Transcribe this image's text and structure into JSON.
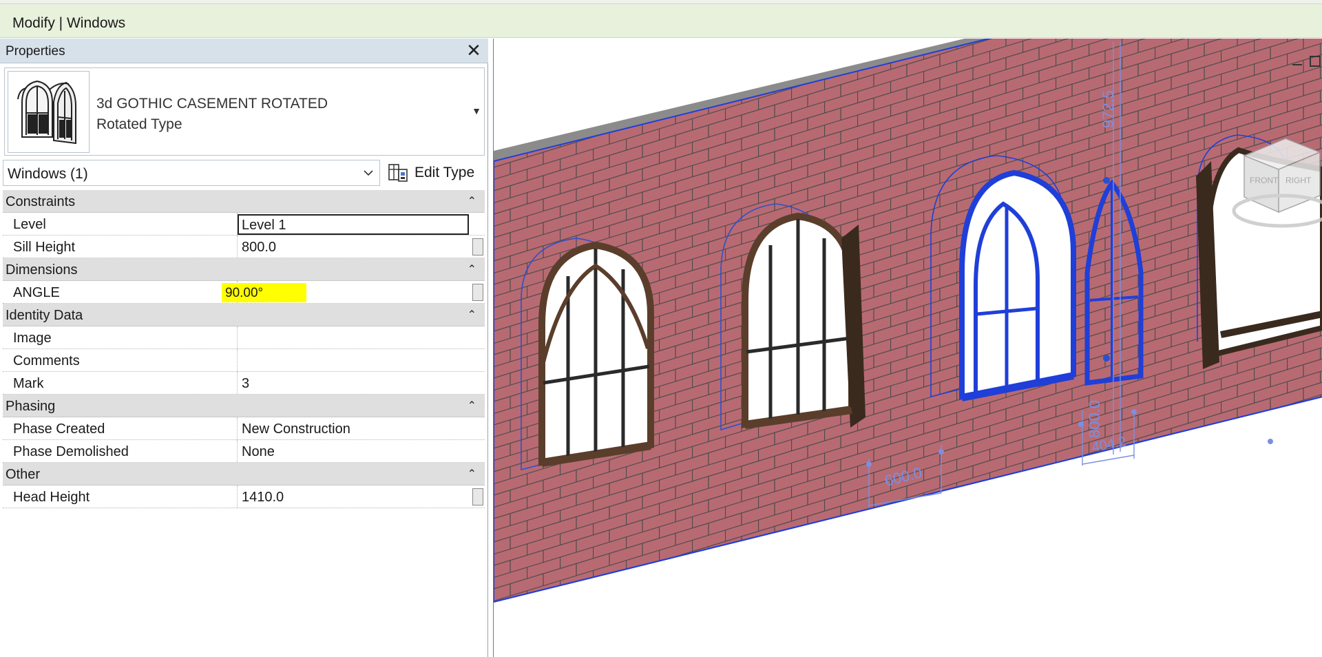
{
  "app": {
    "context_tab": "Modify | Windows"
  },
  "properties": {
    "title": "Properties",
    "close_glyph": "✕",
    "type": {
      "name": "3d GOTHIC CASEMENT ROTATED",
      "subtype": "Rotated Type"
    },
    "filter": "Windows (1)",
    "edit_type_label": "Edit Type",
    "groups": [
      {
        "label": "Constraints",
        "rows": [
          {
            "name": "Level",
            "value": "Level 1"
          },
          {
            "name": "Sill Height",
            "value": "800.0"
          }
        ]
      },
      {
        "label": "Dimensions",
        "rows": [
          {
            "name": "ANGLE",
            "value": "90.00°"
          }
        ]
      },
      {
        "label": "Identity Data",
        "rows": [
          {
            "name": "Image",
            "value": ""
          },
          {
            "name": "Comments",
            "value": ""
          },
          {
            "name": "Mark",
            "value": "3"
          }
        ]
      },
      {
        "label": "Phasing",
        "rows": [
          {
            "name": "Phase Created",
            "value": "New Construction"
          },
          {
            "name": "Phase Demolished",
            "value": "None"
          }
        ]
      },
      {
        "label": "Other",
        "rows": [
          {
            "name": "Head Height",
            "value": "1410.0"
          }
        ]
      }
    ]
  },
  "viewport": {
    "dimensions": [
      "600.0",
      "972.5",
      "800.0",
      "404.2"
    ],
    "viewcube": {
      "faces": [
        "FRONT",
        "RIGHT"
      ]
    }
  },
  "colors": {
    "brick": "#b86a72",
    "mortar": "#4a4a4a",
    "selection": "#1f3fd8",
    "frame": "#5a3e2b",
    "highlight": "#ffff00"
  },
  "icons": [
    "close-icon",
    "window-type-thumbnail",
    "chevron-down-icon",
    "edit-type-icon",
    "collapse-icon",
    "viewcube-icon"
  ]
}
